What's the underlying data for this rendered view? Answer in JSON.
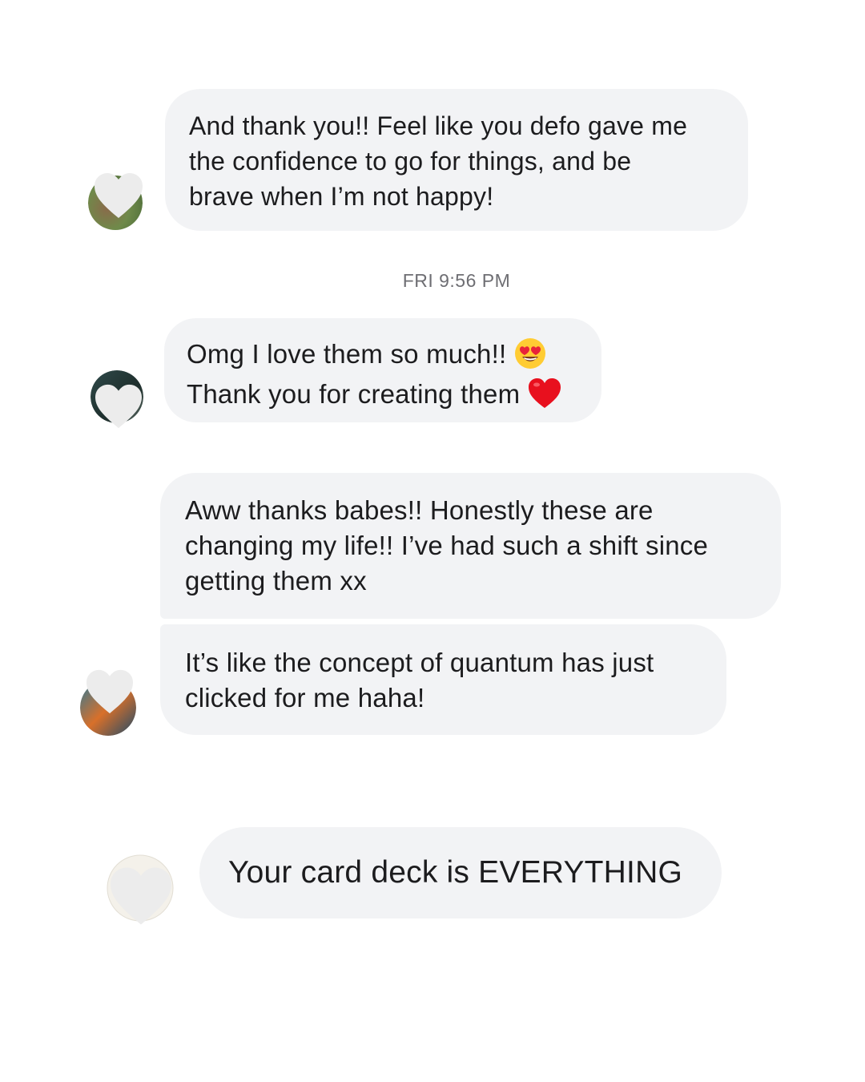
{
  "conversation": {
    "messages": [
      {
        "lines": [
          "And thank you!! Feel like you defo gave me",
          "the confidence to go for things, and be",
          "brave when I’m not happy!"
        ]
      },
      {
        "timestamp": "FRI 9:56 PM"
      },
      {
        "lines": [
          "Omg I love them so much!!",
          "Thank you for creating them"
        ],
        "emojis": [
          "heart-eyes-emoji",
          "red-heart-emoji"
        ]
      },
      {
        "lines": [
          "Aww thanks babes!! Honestly these are",
          "changing my life!! I’ve had such a shift since",
          "getting them xx"
        ]
      },
      {
        "lines": [
          "It’s like the concept of quantum has just",
          "clicked for me haha!"
        ]
      },
      {
        "lines": [
          "Your card deck is EVERYTHING"
        ]
      }
    ]
  },
  "colors": {
    "bubble_background": "#f2f3f5",
    "text": "#1c1c1e",
    "timestamp_text": "#6e6e73",
    "heart_overlay": "#e8e8e8"
  },
  "icons": {
    "avatar_cover": "heart-icon"
  }
}
